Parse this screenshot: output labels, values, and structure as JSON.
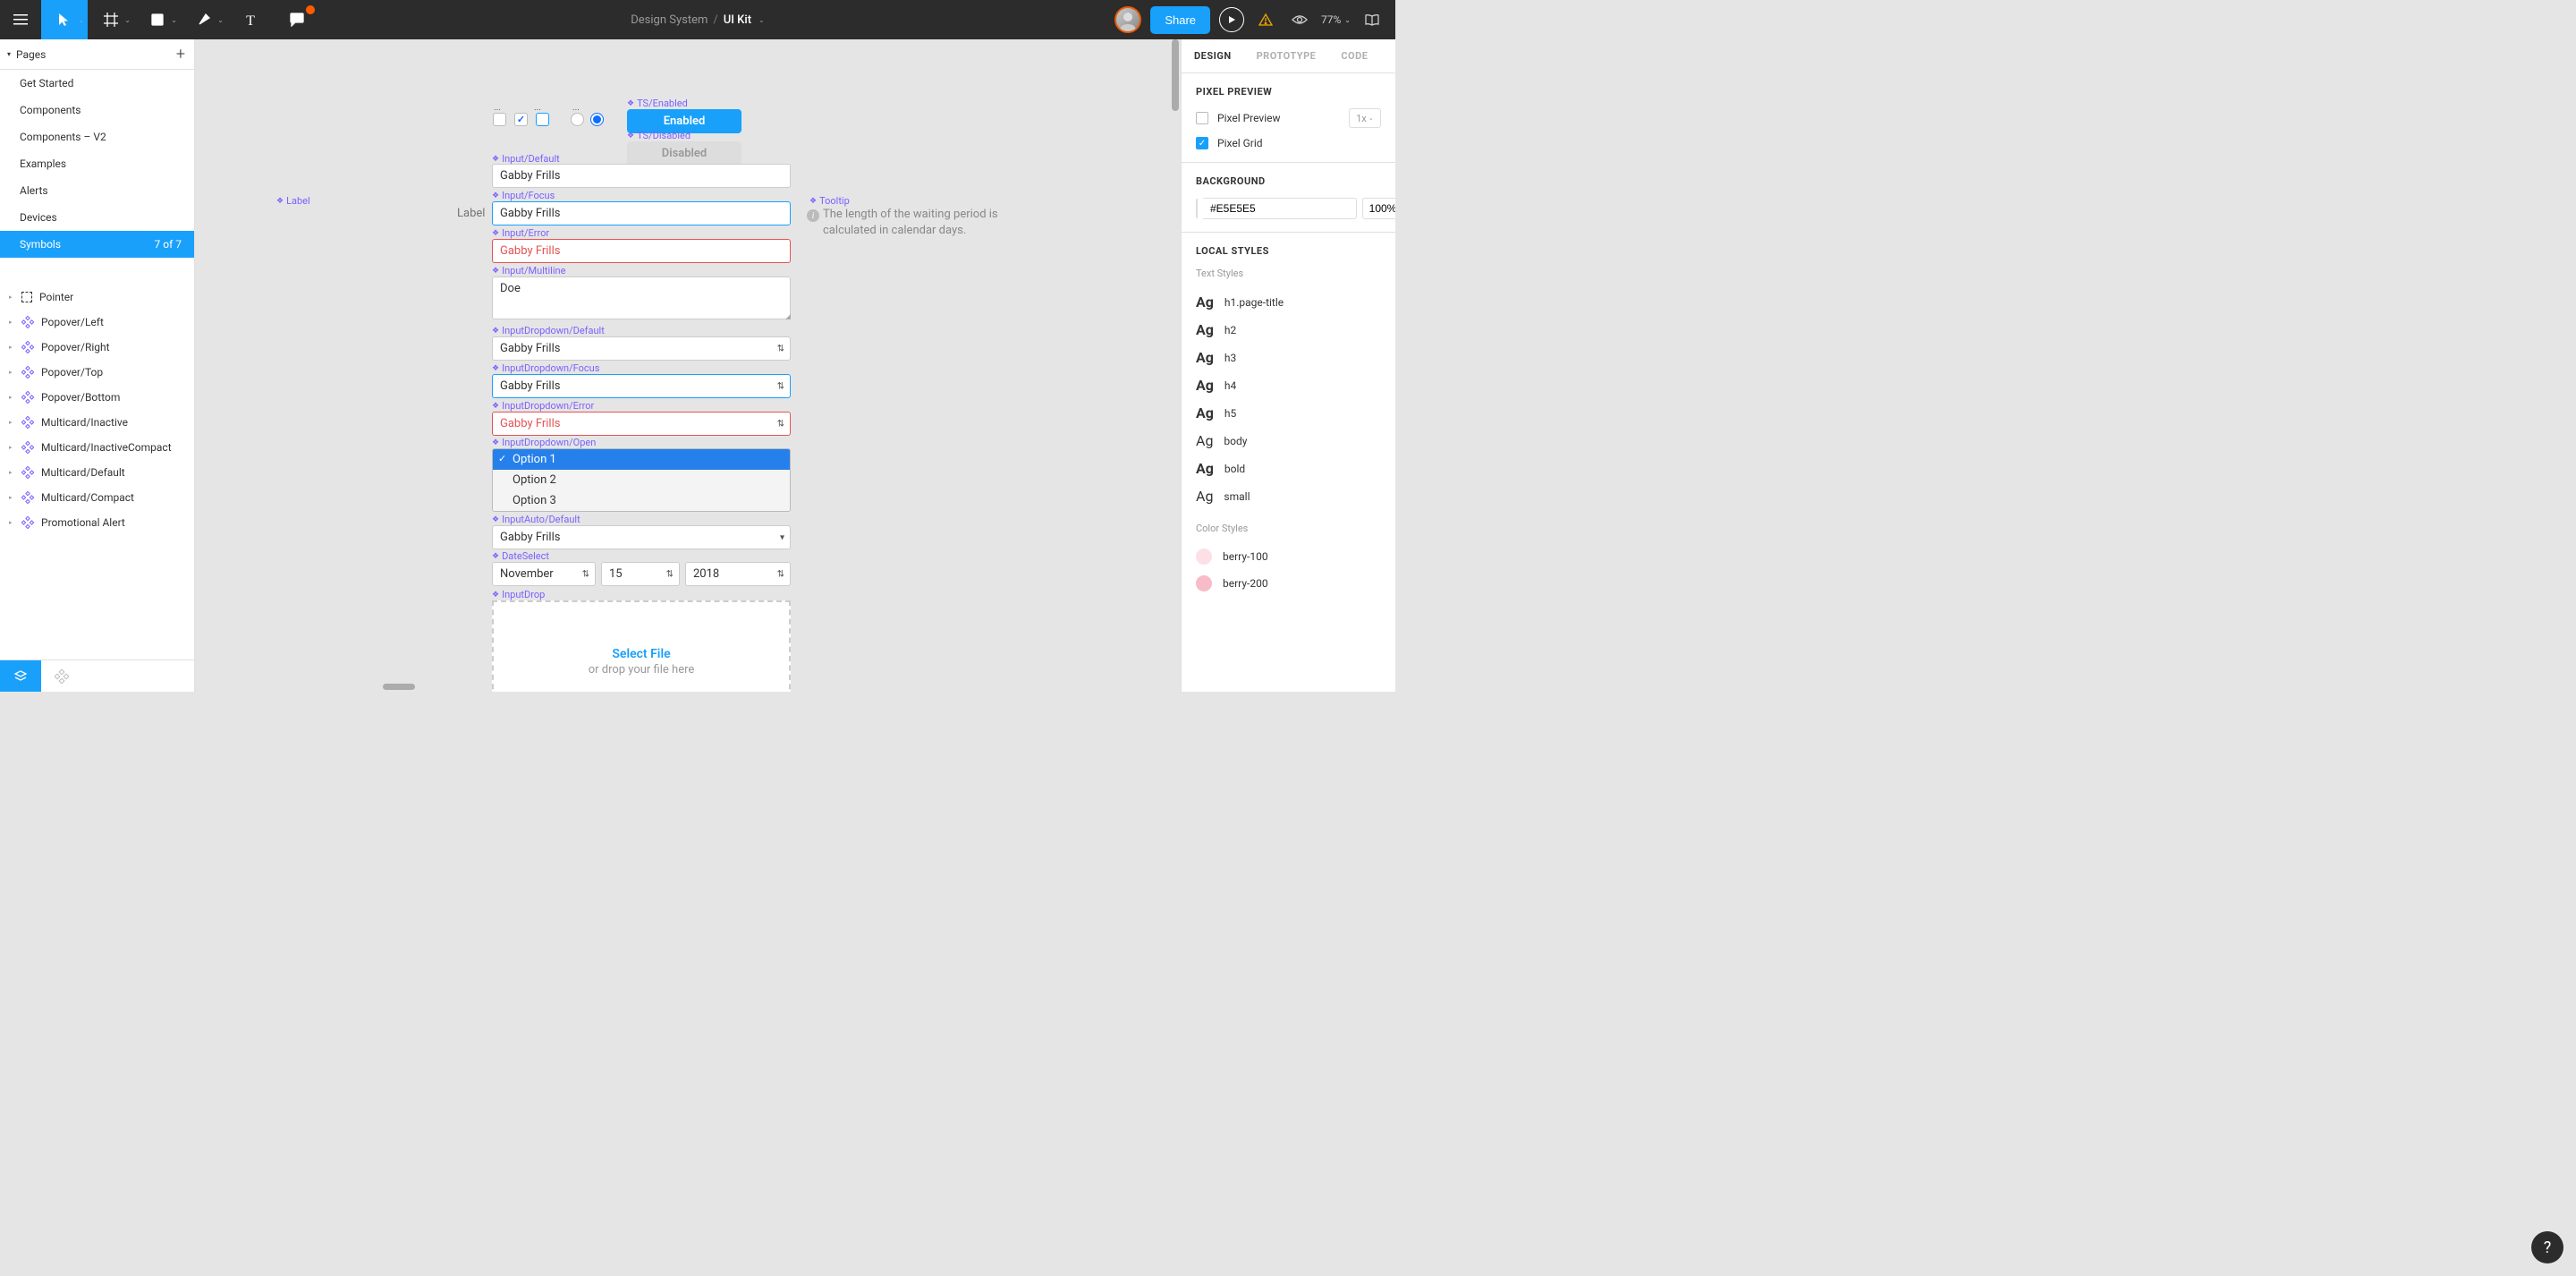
{
  "topbar": {
    "breadcrumb_parent": "Design System",
    "breadcrumb_current": "UI Kit",
    "share_label": "Share",
    "zoom": "77%"
  },
  "left": {
    "pages_label": "Pages",
    "pages": [
      {
        "name": "Get Started"
      },
      {
        "name": "Components"
      },
      {
        "name": "Components – V2"
      },
      {
        "name": "Examples"
      },
      {
        "name": "Alerts"
      },
      {
        "name": "Devices"
      },
      {
        "name": "Symbols",
        "active": true,
        "badge": "7 of 7"
      }
    ],
    "layers": [
      {
        "name": "Pointer",
        "icon": "dashed"
      },
      {
        "name": "Popover/Left",
        "icon": "component"
      },
      {
        "name": "Popover/Right",
        "icon": "component"
      },
      {
        "name": "Popover/Top",
        "icon": "component"
      },
      {
        "name": "Popover/Bottom",
        "icon": "component"
      },
      {
        "name": "Multicard/Inactive",
        "icon": "component"
      },
      {
        "name": "Multicard/InactiveCompact",
        "icon": "component"
      },
      {
        "name": "Multicard/Default",
        "icon": "component"
      },
      {
        "name": "Multicard/Compact",
        "icon": "component"
      },
      {
        "name": "Promotional Alert",
        "icon": "component"
      }
    ]
  },
  "canvas": {
    "label_text": "Label",
    "frame_label_label": "Label",
    "ts_enabled": "TS/Enabled",
    "ts_disabled": "TS/Disabled",
    "enabled_btn": "Enabled",
    "disabled_btn": "Disabled",
    "tooltip_label": "Tooltip",
    "tooltip_text1": "The length of the waiting period is",
    "tooltip_text2": "calculated in calendar days.",
    "input_default_label": "Input/Default",
    "input_focus_label": "Input/Focus",
    "input_error_label": "Input/Error",
    "input_multiline_label": "Input/Multiline",
    "inputdd_default_label": "InputDropdown/Default",
    "inputdd_focus_label": "InputDropdown/Focus",
    "inputdd_error_label": "InputDropdown/Error",
    "inputdd_open_label": "InputDropdown/Open",
    "inputauto_default_label": "InputAuto/Default",
    "dateselect_label": "DateSelect",
    "inputdrop_label": "InputDrop",
    "gabby": "Gabby Frills",
    "doe": "Doe",
    "option1": "Option 1",
    "option2": "Option 2",
    "option3": "Option 3",
    "date_month": "November",
    "date_day": "15",
    "date_year": "2018",
    "select_file": "Select File",
    "drop_text": "or drop your file here"
  },
  "right": {
    "tab_design": "DESIGN",
    "tab_prototype": "PROTOTYPE",
    "tab_code": "CODE",
    "pixel_preview_title": "PIXEL PREVIEW",
    "pixel_preview_label": "Pixel Preview",
    "pixel_preview_scale": "1x",
    "pixel_grid_label": "Pixel Grid",
    "background_title": "BACKGROUND",
    "background_hex": "#E5E5E5",
    "background_opacity": "100%",
    "local_styles_title": "LOCAL STYLES",
    "text_styles_label": "Text Styles",
    "text_styles": [
      {
        "name": "h1.page-title",
        "weight": "bold"
      },
      {
        "name": "h2",
        "weight": "bold"
      },
      {
        "name": "h3",
        "weight": "bold"
      },
      {
        "name": "h4",
        "weight": "bold"
      },
      {
        "name": "h5",
        "weight": "bold"
      },
      {
        "name": "body",
        "weight": "light"
      },
      {
        "name": "bold",
        "weight": "bold"
      },
      {
        "name": "small",
        "weight": "light"
      }
    ],
    "color_styles_label": "Color Styles",
    "color_styles": [
      {
        "name": "berry-100",
        "color": "#fce0e6"
      },
      {
        "name": "berry-200",
        "color": "#f7bcc8"
      }
    ]
  },
  "help": "?"
}
